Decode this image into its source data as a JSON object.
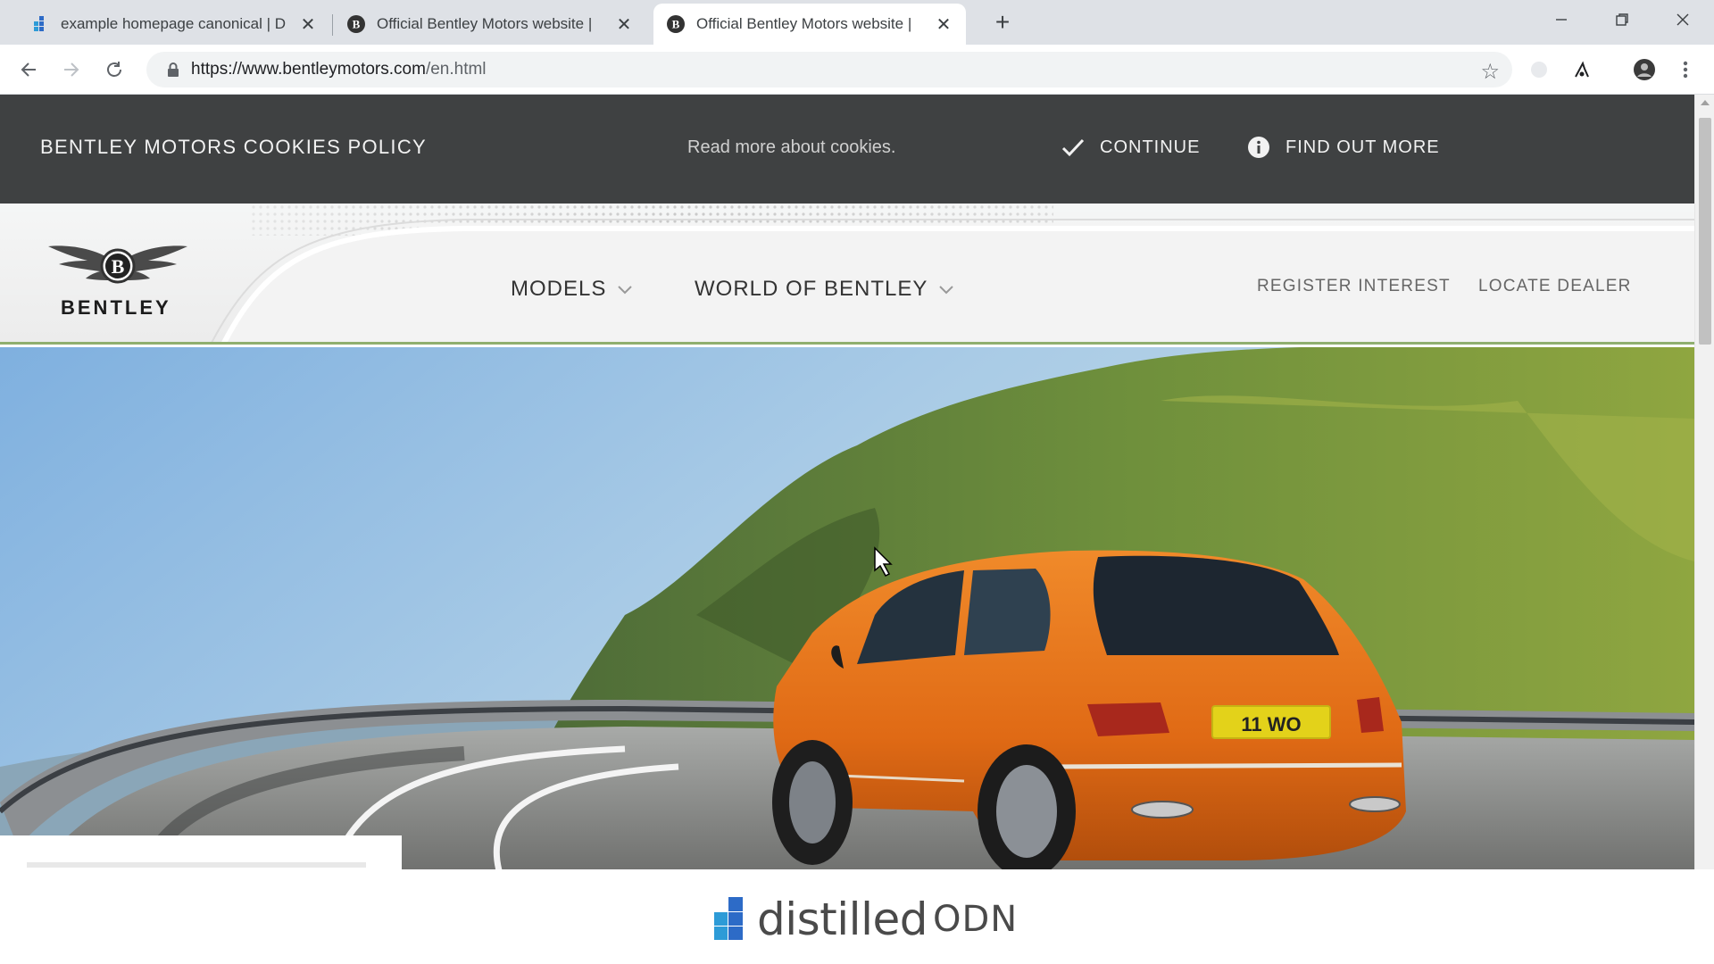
{
  "browser": {
    "tabs": [
      {
        "title": "example homepage canonical | D",
        "favicon": "distilled-favicon",
        "active": false
      },
      {
        "title": "Official Bentley Motors website |",
        "favicon": "bentley-favicon",
        "active": false
      },
      {
        "title": "Official Bentley Motors website |",
        "favicon": "bentley-favicon",
        "active": true
      }
    ],
    "new_tab": "+",
    "url": {
      "host": "https://www.bentleymotors.com",
      "path": "/en.html"
    },
    "icons": [
      "back-icon",
      "forward-icon",
      "reload-icon",
      "lock-icon",
      "star-icon",
      "extension-icon",
      "profile-icon",
      "menu-icon"
    ]
  },
  "cookie_bar": {
    "title": "BENTLEY MOTORS COOKIES POLICY",
    "read_more": "Read more about cookies.",
    "continue_label": "CONTINUE",
    "find_out_label": "FIND OUT MORE"
  },
  "site_nav": {
    "logo_text": "BENTLEY",
    "models_label": "MODELS",
    "world_label": "WORLD OF BENTLEY",
    "register_label": "REGISTER INTEREST",
    "dealer_label": "LOCATE DEALER"
  },
  "hero": {
    "plate_text": "11 WO"
  },
  "watermark": {
    "word": "distilled",
    "suffix": "ODN"
  },
  "colors": {
    "cookie_bar_bg": "#3f4142",
    "nav_accent": "#8faf6f",
    "car_orange": "#e8731f"
  }
}
